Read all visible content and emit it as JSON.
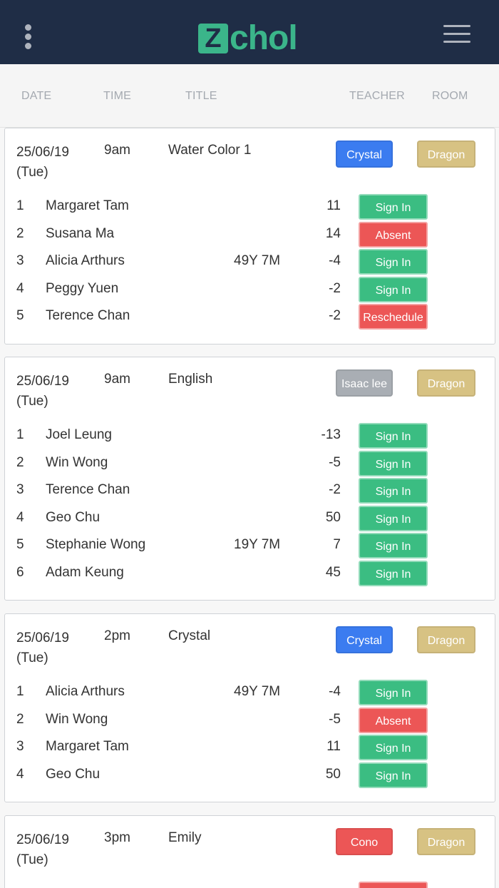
{
  "app": {
    "logo_letter": "Z",
    "logo_text": "chol"
  },
  "columns": {
    "date": "DATE",
    "time": "TIME",
    "title": "TITLE",
    "teacher": "TEACHER",
    "room": "ROOM"
  },
  "colors": {
    "navbar": "#1f2d46",
    "logo_green": "#3bb58a",
    "sign_in": "#3bbd82",
    "absent": "#ec5656",
    "reschedule": "#ec5656",
    "teacher_blue": "#3b7cf0",
    "teacher_grey": "#a9aeb4",
    "teacher_red": "#ec5656",
    "room_gold": "#d7c283"
  },
  "sessions": [
    {
      "date": "25/06/19",
      "weekday": "(Tue)",
      "time": "9am",
      "title": "Water Color 1",
      "teacher": "Crystal",
      "teacher_color": "#3b7cf0",
      "room": "Dragon",
      "students": [
        {
          "num": "1",
          "name": "Margaret Tam",
          "age": "",
          "score": "11",
          "action": "Sign In",
          "action_type": "sign_in"
        },
        {
          "num": "2",
          "name": "Susana Ma",
          "age": "",
          "score": "14",
          "action": "Absent",
          "action_type": "absent"
        },
        {
          "num": "3",
          "name": "Alicia Arthurs",
          "age": "49Y 7M",
          "score": "-4",
          "action": "Sign In",
          "action_type": "sign_in"
        },
        {
          "num": "4",
          "name": "Peggy Yuen",
          "age": "",
          "score": "-2",
          "action": "Sign In",
          "action_type": "sign_in"
        },
        {
          "num": "5",
          "name": "Terence Chan",
          "age": "",
          "score": "-2",
          "action": "Reschedule",
          "action_type": "reschedule"
        }
      ]
    },
    {
      "date": "25/06/19",
      "weekday": "(Tue)",
      "time": "9am",
      "title": "English",
      "teacher": "Isaac lee",
      "teacher_color": "#a9aeb4",
      "room": "Dragon",
      "students": [
        {
          "num": "1",
          "name": "Joel Leung",
          "age": "",
          "score": "-13",
          "action": "Sign In",
          "action_type": "sign_in"
        },
        {
          "num": "2",
          "name": "Win Wong",
          "age": "",
          "score": "-5",
          "action": "Sign In",
          "action_type": "sign_in"
        },
        {
          "num": "3",
          "name": "Terence Chan",
          "age": "",
          "score": "-2",
          "action": "Sign In",
          "action_type": "sign_in"
        },
        {
          "num": "4",
          "name": "Geo Chu",
          "age": "",
          "score": "50",
          "action": "Sign In",
          "action_type": "sign_in"
        },
        {
          "num": "5",
          "name": "Stephanie Wong",
          "age": "19Y 7M",
          "score": "7",
          "action": "Sign In",
          "action_type": "sign_in"
        },
        {
          "num": "6",
          "name": "Adam Keung",
          "age": "",
          "score": "45",
          "action": "Sign In",
          "action_type": "sign_in"
        }
      ]
    },
    {
      "date": "25/06/19",
      "weekday": "(Tue)",
      "time": "2pm",
      "title": "Crystal",
      "teacher": "Crystal",
      "teacher_color": "#3b7cf0",
      "room": "Dragon",
      "students": [
        {
          "num": "1",
          "name": "Alicia Arthurs",
          "age": "49Y 7M",
          "score": "-4",
          "action": "Sign In",
          "action_type": "sign_in"
        },
        {
          "num": "2",
          "name": "Win Wong",
          "age": "",
          "score": "-5",
          "action": "Absent",
          "action_type": "absent"
        },
        {
          "num": "3",
          "name": "Margaret Tam",
          "age": "",
          "score": "11",
          "action": "Sign In",
          "action_type": "sign_in"
        },
        {
          "num": "4",
          "name": "Geo Chu",
          "age": "",
          "score": "50",
          "action": "Sign In",
          "action_type": "sign_in"
        }
      ]
    },
    {
      "date": "25/06/19",
      "weekday": "(Tue)",
      "time": "3pm",
      "title": "Emily",
      "teacher": "Cono",
      "teacher_color": "#ec5656",
      "room": "Dragon",
      "students": []
    }
  ]
}
